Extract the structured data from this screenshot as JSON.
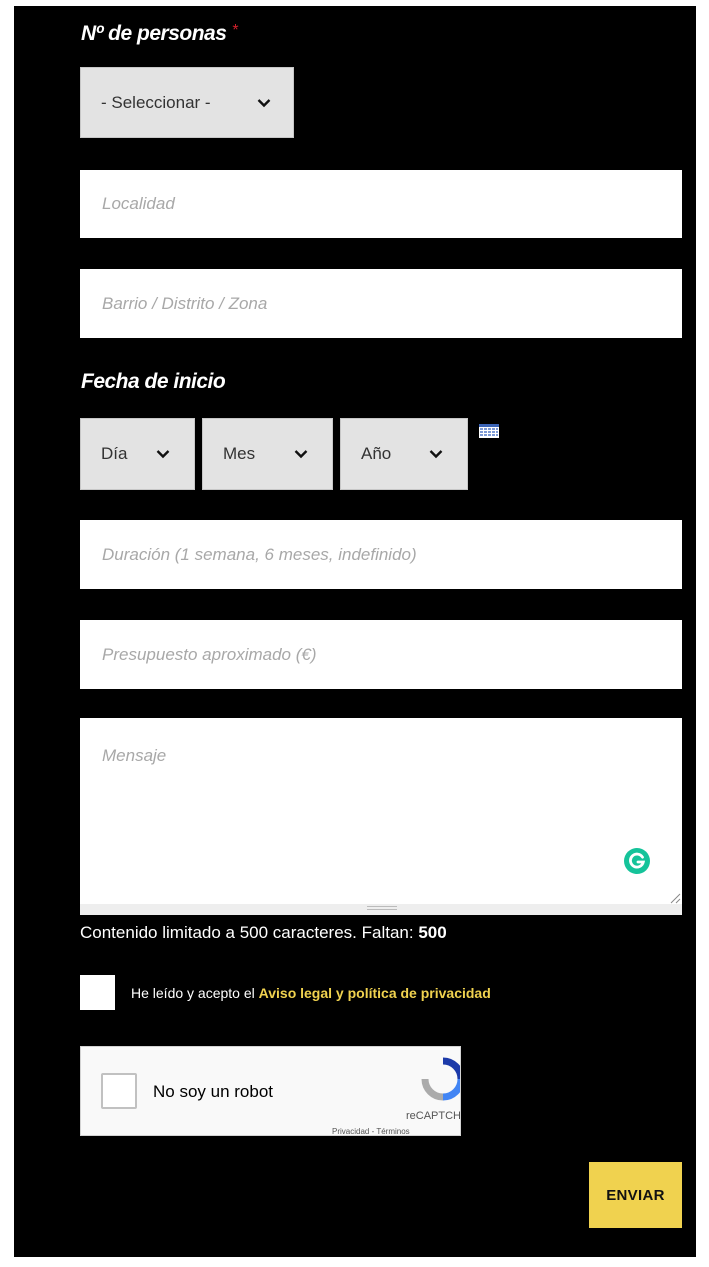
{
  "colors": {
    "panel_bg": "#000000",
    "accent_yellow": "#f0d24f",
    "required_red": "#d3202b",
    "grammarly_green": "#15c39a"
  },
  "persons": {
    "label": "Nº de personas",
    "required_mark": "*",
    "select_value": "- Seleccionar -"
  },
  "fields": {
    "localidad_placeholder": "Localidad",
    "barrio_placeholder": "Barrio / Distrito / Zona",
    "duracion_placeholder": "Duración (1 semana, 6 meses, indefinido)",
    "presupuesto_placeholder": "Presupuesto aproximado (€)",
    "mensaje_placeholder": "Mensaje"
  },
  "start_date": {
    "label": "Fecha de inicio",
    "day": "Día",
    "month": "Mes",
    "year": "Año",
    "calendar_icon": "calendar-icon"
  },
  "counter": {
    "text": "Contenido limitado a 500 caracteres. Faltan:",
    "remaining": "500"
  },
  "consent": {
    "text": "He leído y acepto el",
    "link": "Aviso legal y política de privacidad"
  },
  "recaptcha": {
    "label": "No soy un robot",
    "brand": "reCAPTCHA",
    "privacy": "Privacidad",
    "separator": "-",
    "terms": "Términos"
  },
  "submit_label": "ENVIAR"
}
